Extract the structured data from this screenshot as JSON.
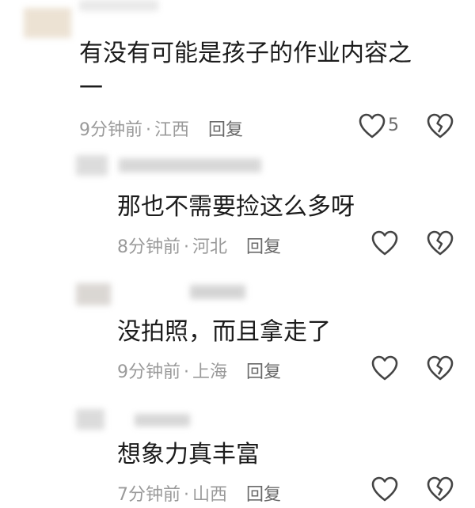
{
  "comments": [
    {
      "text_line1": "有没有可能是孩子的作业内容之",
      "text_line2": "一",
      "time": "9分钟前",
      "location": "江西",
      "reply": "回复",
      "likes": "5"
    },
    {
      "text_line1": "那也不需要捡这么多呀",
      "time": "8分钟前",
      "location": "河北",
      "reply": "回复"
    },
    {
      "text_line1": "没拍照，而且拿走了",
      "time": "9分钟前",
      "location": "上海",
      "reply": "回复"
    },
    {
      "text_line1": "想象力真丰富",
      "time": "7分钟前",
      "location": "山西",
      "reply": "回复"
    }
  ],
  "meta_separator": "·"
}
